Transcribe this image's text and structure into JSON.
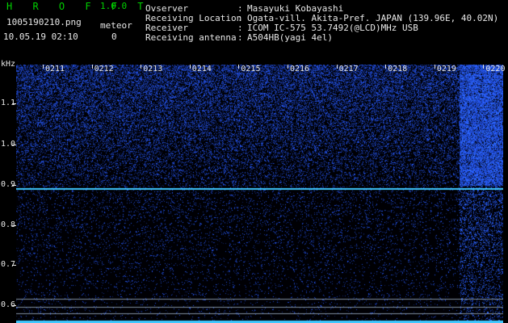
{
  "app": {
    "title": "H R O F F T",
    "version": "1.0.0"
  },
  "file": {
    "name": "1005190210.png",
    "datetime": "10.05.19 02:10"
  },
  "meteor": {
    "label": "meteor",
    "count": "0"
  },
  "info": [
    {
      "label": "Ovserver",
      "value": "Masayuki Kobayashi"
    },
    {
      "label": "Receiving Location",
      "value": "Ogata-vill. Akita-Pref. JAPAN (139.96E, 40.02N)"
    },
    {
      "label": "Receiver",
      "value": "ICOM IC-575 53.7492(@LCD)MHz USB"
    },
    {
      "label": "Receiving antenna",
      "value": "A504HB(yagi 4el)"
    }
  ],
  "separator": ":",
  "axis": {
    "y_unit": "kHz",
    "y_ticks": [
      "1.1",
      "1.0",
      "0.9",
      "0.8",
      "0.7",
      "0.6"
    ],
    "x_ticks": [
      "0211",
      "0212",
      "0213",
      "0214",
      "0215",
      "0216",
      "0217",
      "0218",
      "0219",
      "0220"
    ]
  },
  "colors": {
    "title": "#00d000",
    "text": "#e8e8e8",
    "signal": "#3070ff",
    "trace": "#40c8ff",
    "background": "#000000"
  }
}
